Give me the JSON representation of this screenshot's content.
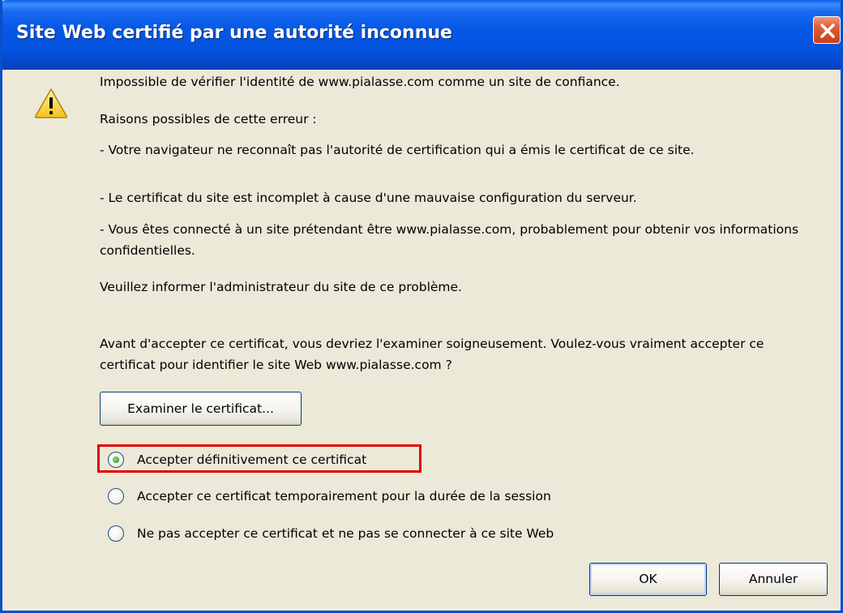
{
  "window": {
    "title": "Site Web certifié par une autorité inconnue"
  },
  "message": {
    "line1": "Impossible de vérifier l'identité de www.pialasse.com comme un site de confiance.",
    "reasons_heading": "Raisons possibles de cette erreur :",
    "reason1": "- Votre navigateur ne reconnaît pas l'autorité de certification qui a émis le certificat de ce site.",
    "reason2": "- Le certificat du site est incomplet à cause d'une mauvaise configuration du serveur.",
    "reason3": "- Vous êtes connecté à un site prétendant être www.pialasse.com, probablement pour obtenir vos informations confidentielles.",
    "inform": "Veuillez informer l'administrateur du site de ce problème.",
    "question": "Avant d'accepter ce certificat, vous devriez l'examiner soigneusement. Voulez-vous vraiment accepter ce certificat pour identifier le site Web www.pialasse.com ?"
  },
  "buttons": {
    "examine": "Examiner le certificat...",
    "ok": "OK",
    "cancel": "Annuler"
  },
  "options": [
    {
      "label": "Accepter définitivement ce certificat",
      "selected": true
    },
    {
      "label": "Accepter ce certificat temporairement pour la durée de la session",
      "selected": false
    },
    {
      "label": "Ne pas accepter ce certificat et ne pas se connecter à ce site Web",
      "selected": false
    }
  ],
  "colors": {
    "titlebar": "#0554e0",
    "dialog_bg": "#ece9d8",
    "close_button": "#e06038",
    "highlight_box": "#e00000",
    "radio_selected": "#4bb23f"
  },
  "icons": {
    "warning": "warning-icon",
    "close": "close-icon"
  }
}
